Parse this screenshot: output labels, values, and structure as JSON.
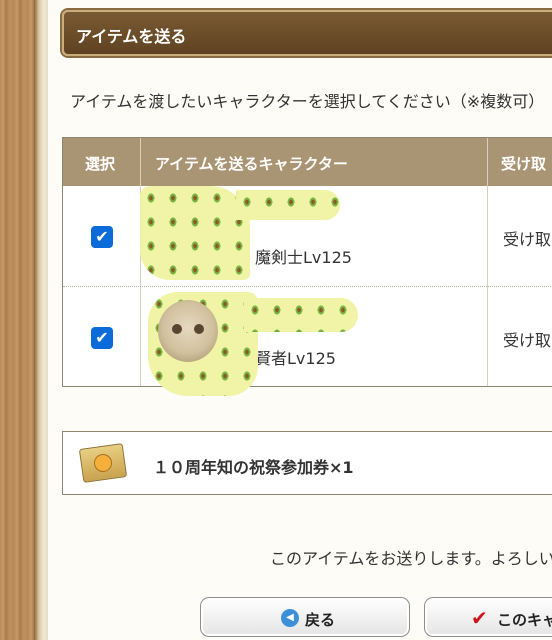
{
  "section": {
    "title": "アイテムを送る"
  },
  "instruction": "アイテムを渡したいキャラクターを選択してください（※複数可）",
  "table": {
    "headers": {
      "select": "選択",
      "character": "アイテムを送るキャラクター",
      "receive": "受け取"
    },
    "rows": [
      {
        "checked": true,
        "character": "魔剣士Lv125",
        "receive": "受け取"
      },
      {
        "checked": true,
        "character": "賢者Lv125",
        "receive": "受け取"
      }
    ]
  },
  "item": {
    "name": "１０周年知の祝祭参加券×1",
    "icon": "ticket-icon"
  },
  "confirm_text": "このアイテムをお送りします。よろしい",
  "buttons": {
    "back": "戻る",
    "send": "このキャ"
  },
  "icons": {
    "check": "✔",
    "back": "◀",
    "checkmark": "✔"
  },
  "colors": {
    "header_bg": "#6b4c2a",
    "table_head_bg": "#a99573",
    "checkbox": "#0b6bd8",
    "accent_red": "#d0121b"
  }
}
